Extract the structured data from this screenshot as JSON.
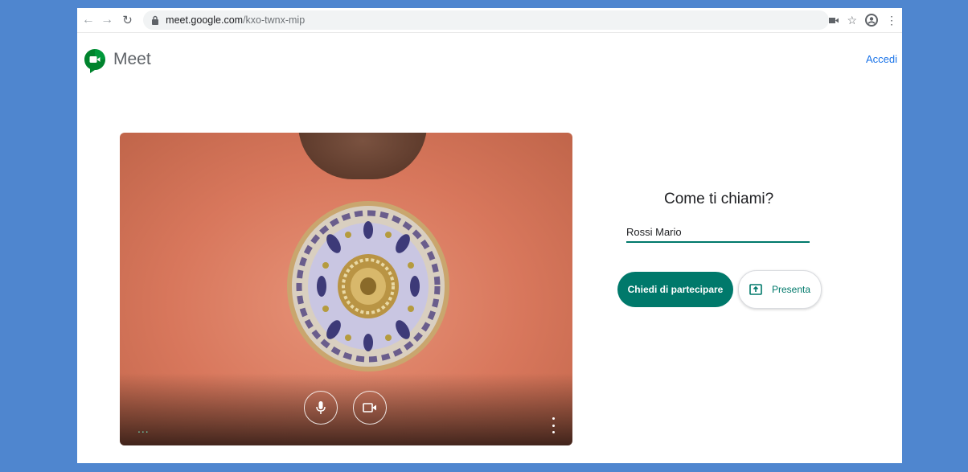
{
  "browser": {
    "url_host": "meet.google.com",
    "url_path": "/kxo-twnx-mip",
    "icons": [
      "back-icon",
      "forward-icon",
      "reload-icon",
      "lock-icon",
      "camera-indicator-icon",
      "star-icon",
      "account-icon",
      "menu-icon"
    ]
  },
  "header": {
    "app_title": "Meet",
    "login_label": "Accedi"
  },
  "preview": {
    "audio_indicator": "...",
    "controls": [
      "microphone-icon",
      "camera-icon",
      "more-options-icon"
    ]
  },
  "join": {
    "prompt": "Come ti chiami?",
    "name_value": "Rossi Mario",
    "join_label": "Chiedi di partecipare",
    "present_label": "Presenta"
  },
  "colors": {
    "accent": "#00796b",
    "page_background": "#4f86cf",
    "link": "#1a73e8"
  }
}
